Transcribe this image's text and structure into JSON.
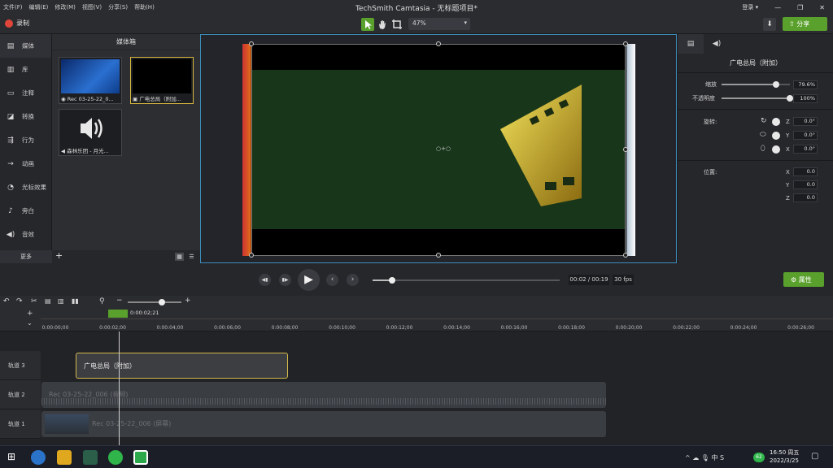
{
  "menubar": {
    "items": [
      "文件(F)",
      "编辑(E)",
      "修改(M)",
      "视图(V)",
      "分享(S)",
      "帮助(H)"
    ],
    "title": "TechSmith Camtasia - 无标题项目*",
    "login_label": "登录 ▾",
    "minimize": "—",
    "restore": "❐",
    "close": "✕"
  },
  "toolbar": {
    "record_label": "录制",
    "zoom_value": "47%",
    "share_label": "分享",
    "accent": "#5aa02c"
  },
  "sidebar": {
    "items": [
      {
        "label": "媒体",
        "icon": "film-icon"
      },
      {
        "label": "库",
        "icon": "library-icon"
      },
      {
        "label": "注释",
        "icon": "annotation-icon"
      },
      {
        "label": "转换",
        "icon": "transition-icon"
      },
      {
        "label": "行为",
        "icon": "behavior-icon"
      },
      {
        "label": "动画",
        "icon": "animation-icon"
      },
      {
        "label": "光标效果",
        "icon": "cursor-icon"
      },
      {
        "label": "旁白",
        "icon": "mic-icon"
      },
      {
        "label": "音效",
        "icon": "audio-icon"
      }
    ],
    "more_label": "更多",
    "add_label": "+"
  },
  "mediabin": {
    "title": "媒体箱",
    "items": [
      {
        "caption": "Rec 03-25-22_0...",
        "type": "video"
      },
      {
        "caption": "广电总局（附加...",
        "type": "image"
      },
      {
        "caption": "森林乐团 - 月光...",
        "type": "audio"
      }
    ]
  },
  "canvas": {
    "center_handle": "○+○"
  },
  "properties": {
    "title": "广电总局（附加）",
    "scale_label": "缩放",
    "scale_value": "79.6%",
    "scale_fraction": 0.796,
    "opacity_label": "不透明度",
    "opacity_value": "100%",
    "opacity_fraction": 1.0,
    "rotation_label": "旋转:",
    "rot_z": "0.0°",
    "rot_y": "0.0°",
    "rot_x": "0.0°",
    "position_label": "位置:",
    "pos_x": "0.0",
    "pos_y": "0.0",
    "pos_z": "0.0",
    "axis_z": "Z",
    "axis_y": "Y",
    "axis_x": "X",
    "props_button": "属性"
  },
  "playback": {
    "time": "00:02 / 00:19",
    "fps": "30 fps",
    "progress_fraction": 0.105
  },
  "timeline": {
    "playhead_time": "0:00:02;21",
    "zoom_minus": "−",
    "zoom_plus": "+",
    "ticks": [
      "0:00:00;00",
      "0:00:02;00",
      "0:00:04;00",
      "0:00:06;00",
      "0:00:08;00",
      "0:00:10;00",
      "0:00:12;00",
      "0:00:14;00",
      "0:00:16;00",
      "0:00:18;00",
      "0:00:20;00",
      "0:00:22;00",
      "0:00:24;00",
      "0:00:26;00"
    ],
    "tracks": [
      {
        "label": "轨道 3",
        "clip": "广电总局（附加）"
      },
      {
        "label": "轨道 2",
        "clip": "Rec 03-25-22_006 (音频)"
      },
      {
        "label": "轨道 1",
        "clip": "Rec 03-25-22_006 (屏幕)"
      }
    ]
  },
  "taskbar": {
    "tray_icons": "^ ☁ 🎙 中 S",
    "time": "16:50 周五",
    "date": "2022/3/25",
    "badge": "62"
  }
}
